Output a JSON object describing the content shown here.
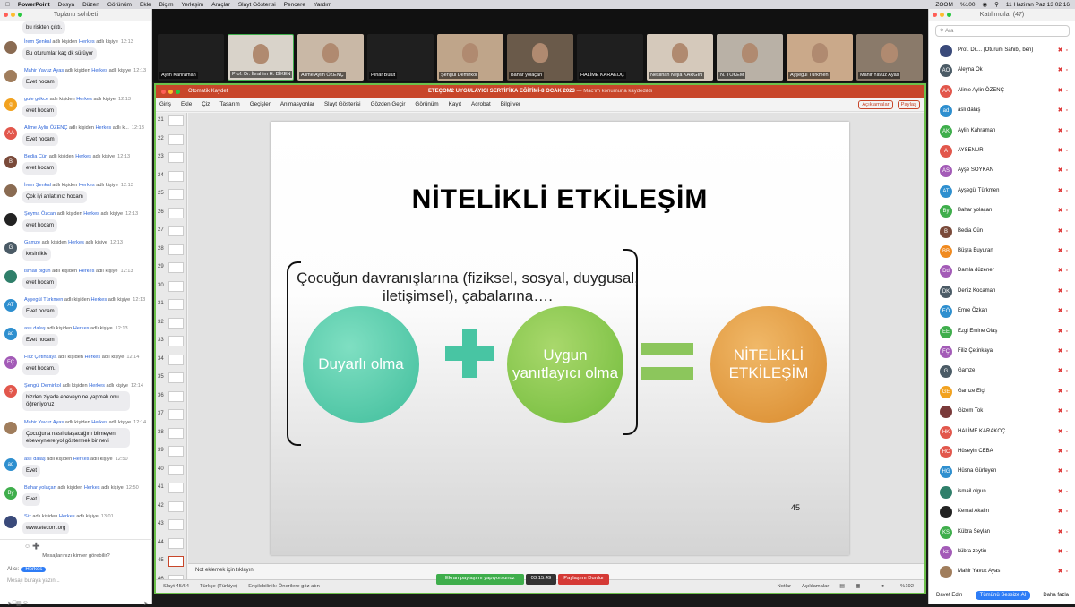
{
  "menubar": {
    "apple": "",
    "app": "PowerPoint",
    "items": [
      "Dosya",
      "Düzen",
      "Görünüm",
      "Ekle",
      "Biçim",
      "Yerleşim",
      "Araçlar",
      "Slayt Gösterisi",
      "Pencere",
      "Yardım"
    ],
    "zoom": "ZOOM",
    "battery": "%100",
    "datetime": "11 Haziran Paz  13 02 16"
  },
  "chat": {
    "title": "Toplantı sohbeti",
    "first_bubble": "bu riskten çıktı.",
    "messages": [
      {
        "initials": "",
        "color": "#8a6b52",
        "name": "İrem Şenkal",
        "text": "adlı kişiden",
        "to": "Herkes",
        "suffix": "adlı kişiye",
        "time": "12:13",
        "body": "Bu oturumlar kaç dk sürüyor"
      },
      {
        "initials": "",
        "color": "#a07d5c",
        "name": "Mahir Yavuz Ayas",
        "text": "adlı kişiden",
        "to": "Herkes",
        "suffix": "adlı kişiye",
        "time": "12:13",
        "body": "Evet hocam"
      },
      {
        "initials": "g",
        "color": "#f2a21f",
        "name": "gule gökce",
        "text": "adlı kişiden",
        "to": "Herkes",
        "suffix": "adlı kişiye",
        "time": "12:13",
        "body": "evet hocam"
      },
      {
        "initials": "AA",
        "color": "#e2574c",
        "name": "Alime Aylin ÖZENÇ",
        "text": "adlı kişiden",
        "to": "Herkes",
        "suffix": "adlı k...",
        "time": "12:13",
        "body": "Evet hocam"
      },
      {
        "initials": "B",
        "color": "#7a4a3a",
        "name": "Bedia Cün",
        "text": "adlı kişiden",
        "to": "Herkes",
        "suffix": "adlı kişiye",
        "time": "12:13",
        "body": "evet hocam"
      },
      {
        "initials": "",
        "color": "#8a6b52",
        "name": "İrem Şenkal",
        "text": "adlı kişiden",
        "to": "Herkes",
        "suffix": "adlı kişiye",
        "time": "12:13",
        "body": "Çok iyi anlattınız hocam"
      },
      {
        "initials": "",
        "color": "#222",
        "name": "Şeyma Özcan",
        "text": "adlı kişiden",
        "to": "Herkes",
        "suffix": "adlı kişiye",
        "time": "12:13",
        "body": "evet hocam"
      },
      {
        "initials": "G",
        "color": "#4b5b66",
        "name": "Gamze",
        "text": "adlı kişiden",
        "to": "Herkes",
        "suffix": "adlı kişiye",
        "time": "12:13",
        "body": "kesinlikle"
      },
      {
        "initials": "",
        "color": "#2f7f6a",
        "name": "ismail olgun",
        "text": "adlı kişiden",
        "to": "Herkes",
        "suffix": "adlı kişiye",
        "time": "12:13",
        "body": "evet hocam"
      },
      {
        "initials": "AT",
        "color": "#2e8fcf",
        "name": "Ayşegül Türkmen",
        "text": "adlı kişiden",
        "to": "Herkes",
        "suffix": "adlı kişiye",
        "time": "12:13",
        "body": "Evet hocam"
      },
      {
        "initials": "ad",
        "color": "#2e8fcf",
        "name": "aslı dalaş",
        "text": "adlı kişiden",
        "to": "Herkes",
        "suffix": "adlı kişiye",
        "time": "12:13",
        "body": "Evet hocam"
      },
      {
        "initials": "FÇ",
        "color": "#a35bb7",
        "name": "Filiz Çetinkaya",
        "text": "adlı kişiden",
        "to": "Herkes",
        "suffix": "adlı kişiye",
        "time": "12:14",
        "body": "evet hocam."
      },
      {
        "initials": "Ş",
        "color": "#e2574c",
        "name": "Şengül Demirkol",
        "text": "adlı kişiden",
        "to": "Herkes",
        "suffix": "adlı kişiye",
        "time": "12:14",
        "body": "bizden ziyade ebeveyn ne yapmalı onu öğreniyoruz"
      },
      {
        "initials": "",
        "color": "#a07d5c",
        "name": "Mahir Yavuz Ayas",
        "text": "adlı kişiden",
        "to": "Herkes",
        "suffix": "adlı kişiye",
        "time": "12:14",
        "body": "Çocuğuna nasıl ulaşacağını bilmeyen ebeveynlere yol göstermek bir nevi"
      },
      {
        "initials": "ad",
        "color": "#2e8fcf",
        "name": "aslı dalaş",
        "text": "adlı kişiden",
        "to": "Herkes",
        "suffix": "adlı kişiye",
        "time": "12:50",
        "body": "Evet"
      },
      {
        "initials": "By",
        "color": "#3fae4c",
        "name": "Bahar yolaçan",
        "text": "adlı kişiden",
        "to": "Herkes",
        "suffix": "adlı kişiye",
        "time": "12:50",
        "body": "Evet"
      },
      {
        "initials": "",
        "color": "#3a4a7a",
        "name": "Siz",
        "text": "adlı kişiden",
        "to": "Herkes",
        "suffix": "adlı kişiye",
        "time": "13:01",
        "body": "www.etecom.org"
      }
    ],
    "who_can_see": "Mesajlarınızı kimler görebilir?",
    "to_label": "Alıcı:",
    "to_value": "Herkes",
    "input_placeholder": "Mesajı buraya yazın..."
  },
  "videos": [
    {
      "name": "Aylin Kahraman"
    },
    {
      "name": "Prof. Dr. İbrahim H. DİKEN"
    },
    {
      "name": "Alime Aylin ÖZENÇ"
    },
    {
      "name": "Pınar Bulut"
    },
    {
      "name": "Şengül Demirkol"
    },
    {
      "name": "Bahar yolaçan"
    },
    {
      "name": "HALİME KARAKOÇ"
    },
    {
      "name": "Neslihan Nejla KARGIN"
    },
    {
      "name": "N. TOKEM"
    },
    {
      "name": "Ayşegül Türkmen"
    },
    {
      "name": "Mahir Yavuz Ayas"
    }
  ],
  "ppt": {
    "autosave": "Otomatik Kaydet",
    "doc_title": "ETEÇOM2 UYGULAYICI SERTİFİKA EĞİTİMİ-8 OCAK 2023",
    "doc_saved": "— Mac'im konumuna kaydedildi",
    "tabs": [
      "Giriş",
      "Ekle",
      "Çiz",
      "Tasarım",
      "Geçişler",
      "Animasyonlar",
      "Slayt Gösterisi",
      "Gözden Geçir",
      "Görünüm",
      "Kayıt",
      "Acrobat",
      "Bilgi ver"
    ],
    "comments_btn": "Açıklamalar",
    "share_btn": "Paylaş",
    "thumb_numbers": [
      "21",
      "22",
      "23",
      "24",
      "25",
      "26",
      "27",
      "28",
      "29",
      "30",
      "31",
      "32",
      "33",
      "34",
      "35",
      "36",
      "37",
      "38",
      "39",
      "40",
      "41",
      "42",
      "43",
      "44",
      "45",
      "46"
    ],
    "selected_slide": "45",
    "slide": {
      "title": "NİTELİKLİ ETKİLEŞİM",
      "text": "Çocuğun davranışlarına (fiziksel, sosyal, duygusal, iletişimsel), çabalarına….",
      "circle1": "Duyarlı olma",
      "circle2": "Uygun yanıtlayıcı olma",
      "circle3": "NİTELİKLİ ETKİLEŞİM",
      "page": "45"
    },
    "notes_placeholder": "Not eklemek için tıklayın",
    "status": {
      "slide": "Slayt 45/64",
      "lang": "Türkçe (Türkiye)",
      "access": "Erişilebilirlik: Önerilere göz atın",
      "notes": "Notlar",
      "comments": "Açıklamalar",
      "zoom": "%192"
    }
  },
  "share_bar": {
    "sharing": "Ekran paylaşımı yapıyorsunuz",
    "timer": "03:15:49",
    "stop": "Paylaşımı Durdur"
  },
  "participants": {
    "title": "Katılımcılar (47)",
    "search_placeholder": "Ara",
    "list": [
      {
        "initials": "",
        "color": "#3a4a7a",
        "name": "Prof. Dr....   (Oturum Sahibi, ben)"
      },
      {
        "initials": "AO",
        "color": "#4b5b66",
        "name": "Aleyna Ok"
      },
      {
        "initials": "AA",
        "color": "#e2574c",
        "name": "Alime Aylin ÖZENÇ"
      },
      {
        "initials": "ad",
        "color": "#2e8fcf",
        "name": "aslı dalaş"
      },
      {
        "initials": "AK",
        "color": "#3fae4c",
        "name": "Aylin Kahraman"
      },
      {
        "initials": "A",
        "color": "#e2574c",
        "name": "AYSENUR"
      },
      {
        "initials": "AS",
        "color": "#a35bb7",
        "name": "Ayşe SOYKAN"
      },
      {
        "initials": "AT",
        "color": "#2e8fcf",
        "name": "Ayşegül Türkmen"
      },
      {
        "initials": "By",
        "color": "#3fae4c",
        "name": "Bahar yolaçan"
      },
      {
        "initials": "B",
        "color": "#7a4a3a",
        "name": "Bedia Cün"
      },
      {
        "initials": "BB",
        "color": "#f08a1f",
        "name": "Büşra Buyuran"
      },
      {
        "initials": "Dd",
        "color": "#a35bb7",
        "name": "Damla düzener"
      },
      {
        "initials": "DK",
        "color": "#4b5b66",
        "name": "Deniz Kocaman"
      },
      {
        "initials": "EÖ",
        "color": "#2e8fcf",
        "name": "Emre Özkan"
      },
      {
        "initials": "EE",
        "color": "#3fae4c",
        "name": "Ezgi Emine Olaş"
      },
      {
        "initials": "FÇ",
        "color": "#a35bb7",
        "name": "Filiz Çetinkaya"
      },
      {
        "initials": "G",
        "color": "#4b5b66",
        "name": "Gamze"
      },
      {
        "initials": "GE",
        "color": "#f2a21f",
        "name": "Gamze Elçi"
      },
      {
        "initials": "",
        "color": "#7a3a3a",
        "name": "Gizem Tok"
      },
      {
        "initials": "HK",
        "color": "#e2574c",
        "name": "HALİME KARAKOÇ"
      },
      {
        "initials": "HC",
        "color": "#e2574c",
        "name": "Hüseyin CEBA"
      },
      {
        "initials": "HG",
        "color": "#2e8fcf",
        "name": "Hüsna Gürleyen"
      },
      {
        "initials": "",
        "color": "#2f7f6a",
        "name": "ismail olgun"
      },
      {
        "initials": "",
        "color": "#222",
        "name": "Kemal Akalın"
      },
      {
        "initials": "KS",
        "color": "#3fae4c",
        "name": "Kübra Seylan"
      },
      {
        "initials": "kz",
        "color": "#a35bb7",
        "name": "kübra zeytin"
      },
      {
        "initials": "",
        "color": "#a07d5c",
        "name": "Mahir Yavuz Ayas"
      }
    ],
    "invite": "Davet Edin",
    "mute_all": "Tümünü Sessize Al",
    "more": "Daha fazla"
  }
}
